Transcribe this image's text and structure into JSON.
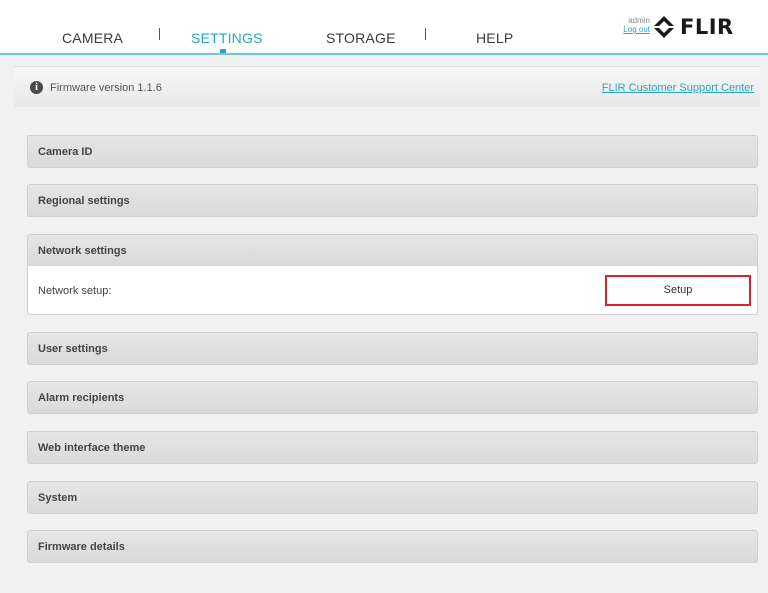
{
  "nav": {
    "items": [
      {
        "label": "CAMERA"
      },
      {
        "label": "SETTINGS",
        "active": true
      },
      {
        "label": "STORAGE"
      },
      {
        "label": "HELP"
      }
    ],
    "user": "admin",
    "logout": "Log out",
    "logo_text": "FLIR",
    "accent_color": "#27a6c0"
  },
  "info": {
    "firmware": "Firmware version 1.1.6",
    "support_link": "FLIR Customer Support Center"
  },
  "sections": [
    {
      "title": "Camera ID"
    },
    {
      "title": "Regional settings"
    },
    {
      "title": "Network settings",
      "expanded": true
    },
    {
      "title": "User settings"
    },
    {
      "title": "Alarm recipients"
    },
    {
      "title": "Web interface theme"
    },
    {
      "title": "System"
    },
    {
      "title": "Firmware details"
    }
  ],
  "network": {
    "row_label": "Network setup:",
    "setup_button": "Setup",
    "highlight_color": "#e0202a"
  }
}
